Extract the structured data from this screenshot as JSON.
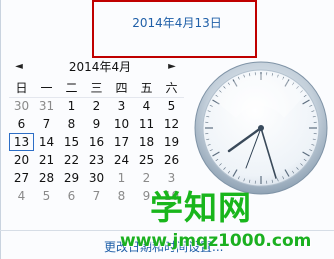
{
  "header": {
    "date_text": "2014年4月13日"
  },
  "calendar": {
    "prev_symbol": "◄",
    "next_symbol": "►",
    "month_label": "2014年4月",
    "weekdays": [
      "日",
      "一",
      "二",
      "三",
      "四",
      "五",
      "六"
    ],
    "weeks": [
      [
        "30",
        "31",
        "1",
        "2",
        "3",
        "4",
        "5"
      ],
      [
        "6",
        "7",
        "8",
        "9",
        "10",
        "11",
        "12"
      ],
      [
        "13",
        "14",
        "15",
        "16",
        "17",
        "18",
        "19"
      ],
      [
        "20",
        "21",
        "22",
        "23",
        "24",
        "25",
        "26"
      ],
      [
        "27",
        "28",
        "29",
        "30",
        "1",
        "2",
        "3"
      ],
      [
        "4",
        "5",
        "6",
        "7",
        "8",
        "9",
        "10"
      ]
    ],
    "today": "13"
  },
  "footer": {
    "link_text": "更改日期和时间设置..."
  },
  "watermark": {
    "title": "学知网",
    "url": "www.jmqz1000.com"
  },
  "colors": {
    "accent": "#1f5fa8",
    "highlight": "#c00000",
    "watermark": "#19b61c"
  }
}
